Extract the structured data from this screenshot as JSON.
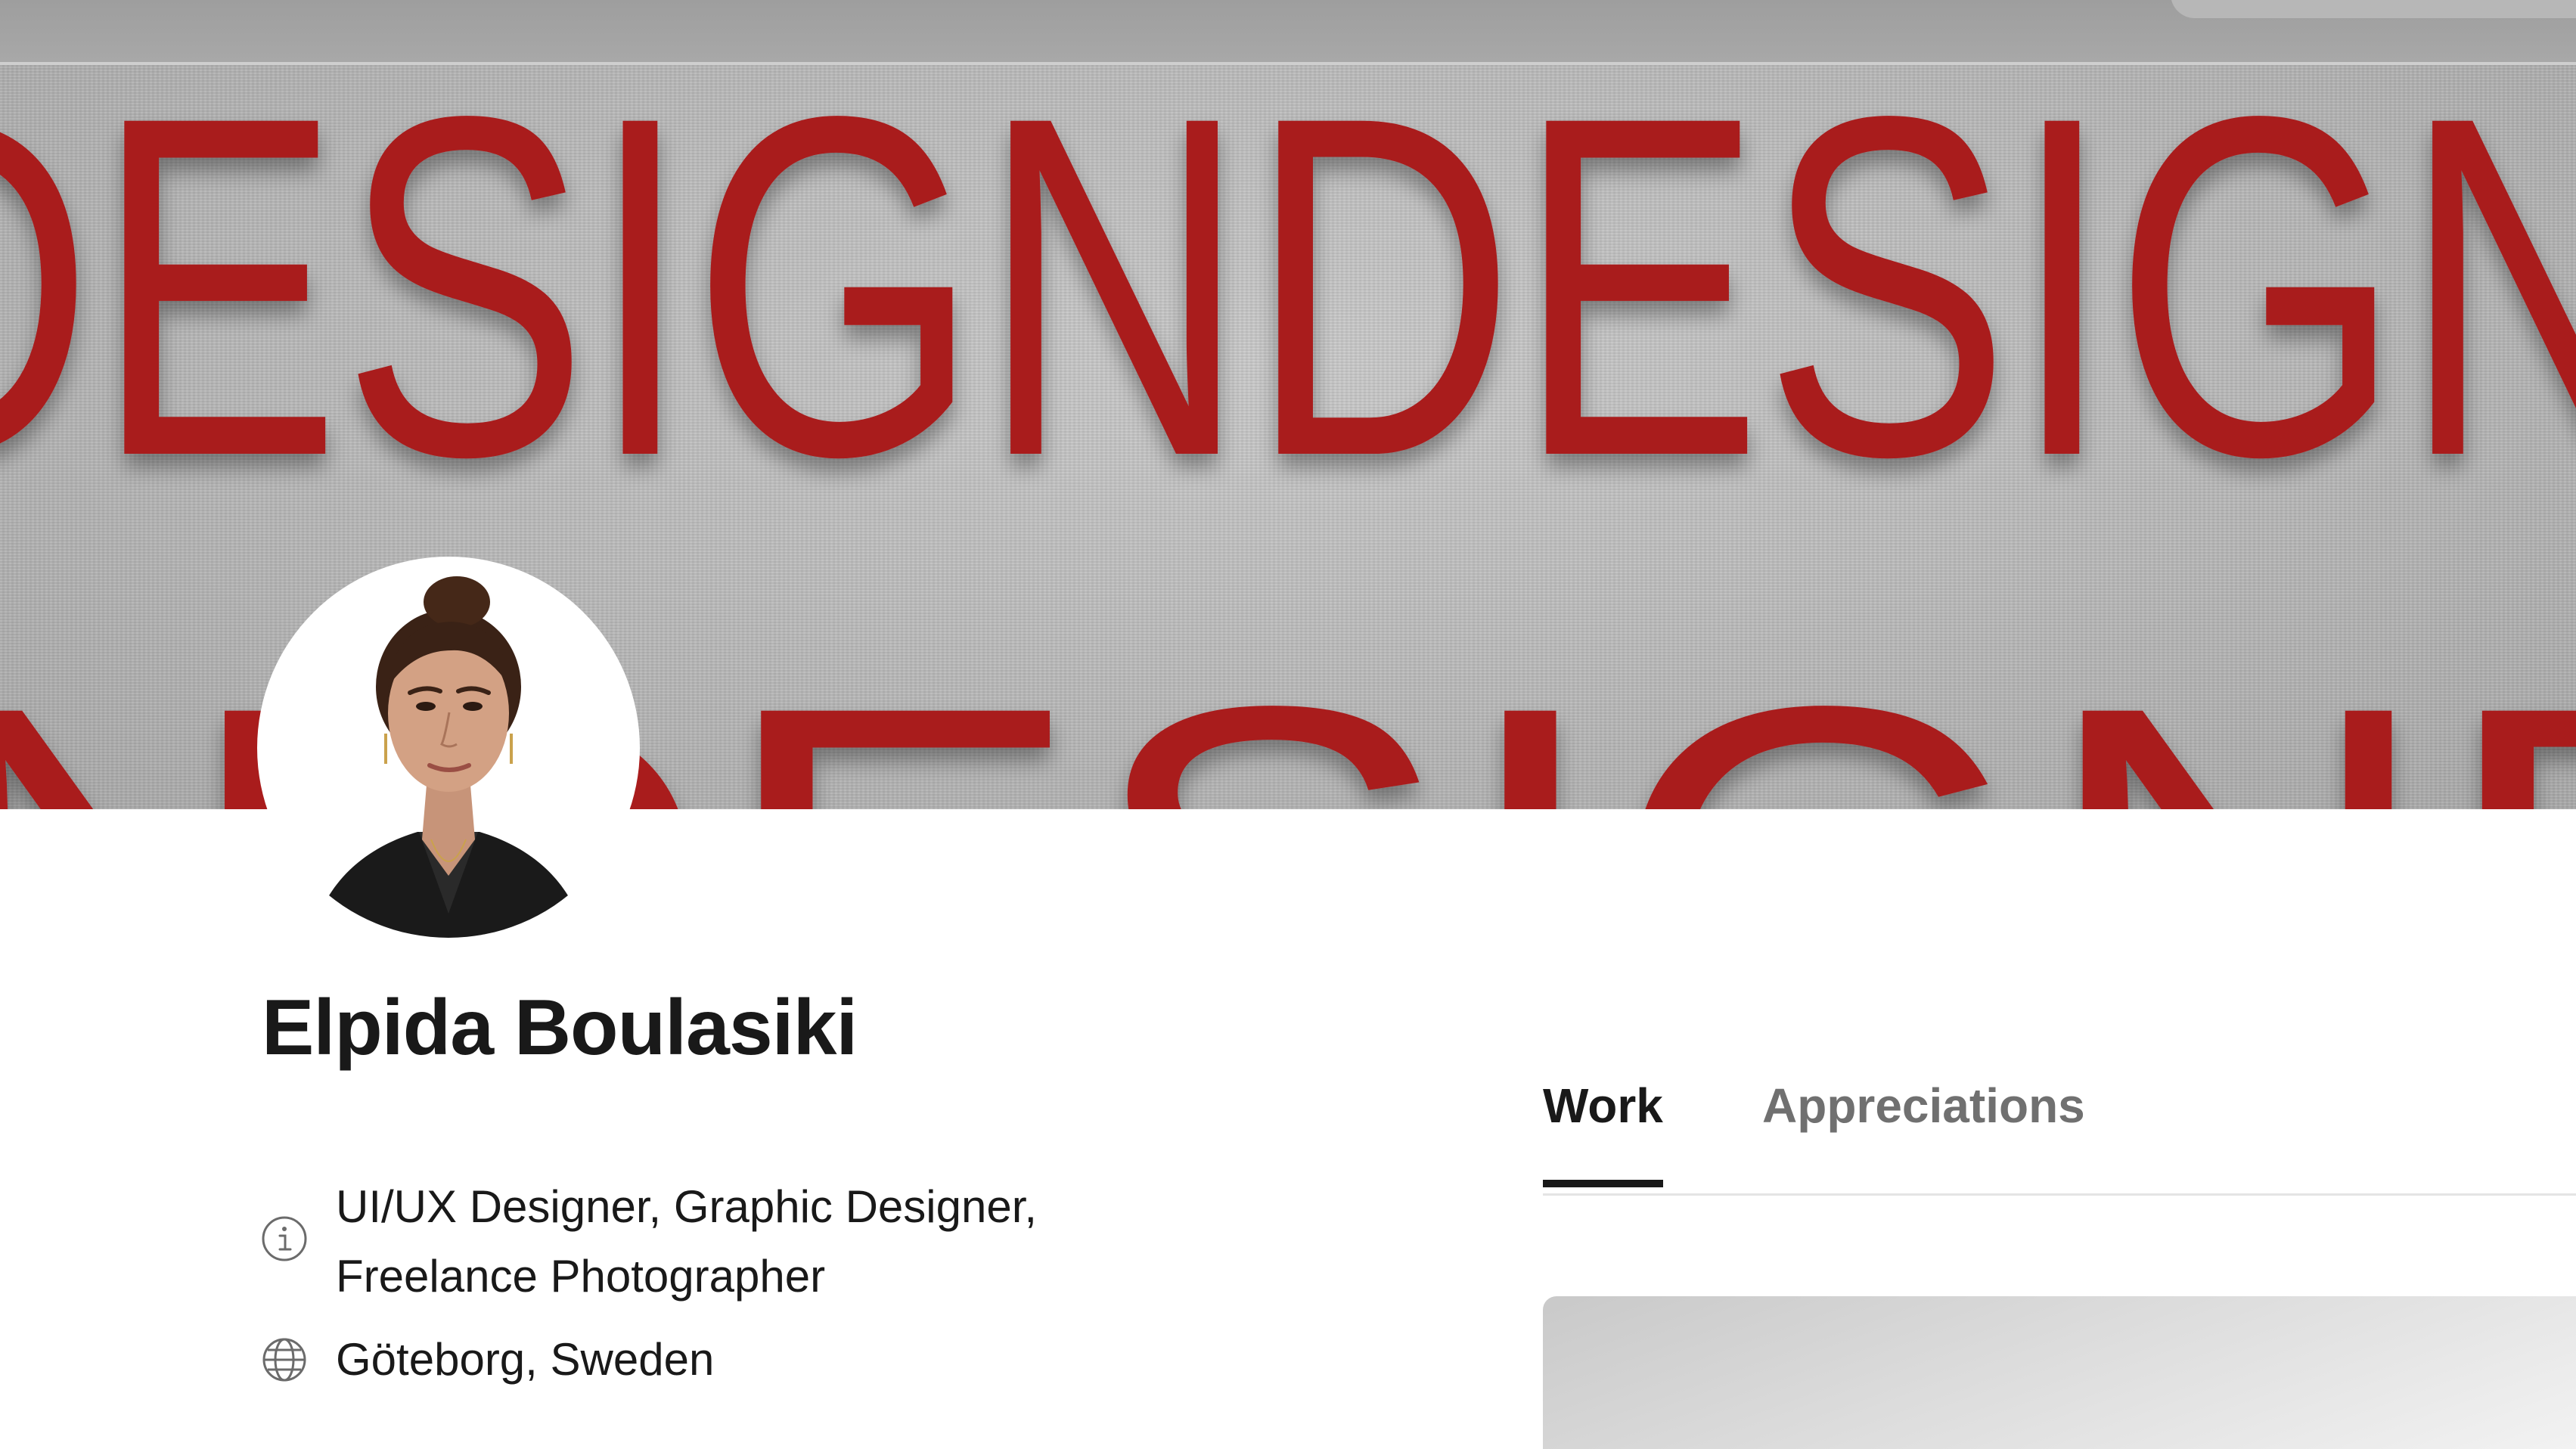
{
  "banner": {
    "pattern_text": "DESIGN",
    "text_color": "#a91b1b"
  },
  "profile": {
    "name": "Elpida Boulasiki",
    "occupation": "UI/UX Designer, Graphic Designer, Freelance Photographer",
    "location": "Göteborg, Sweden"
  },
  "tabs": [
    {
      "label": "Work",
      "active": true
    },
    {
      "label": "Appreciations",
      "active": false
    }
  ],
  "icons": {
    "info": "info-icon",
    "globe": "globe-icon"
  },
  "colors": {
    "text_primary": "#191919",
    "text_secondary": "#707070",
    "divider": "#e4e4e4"
  }
}
